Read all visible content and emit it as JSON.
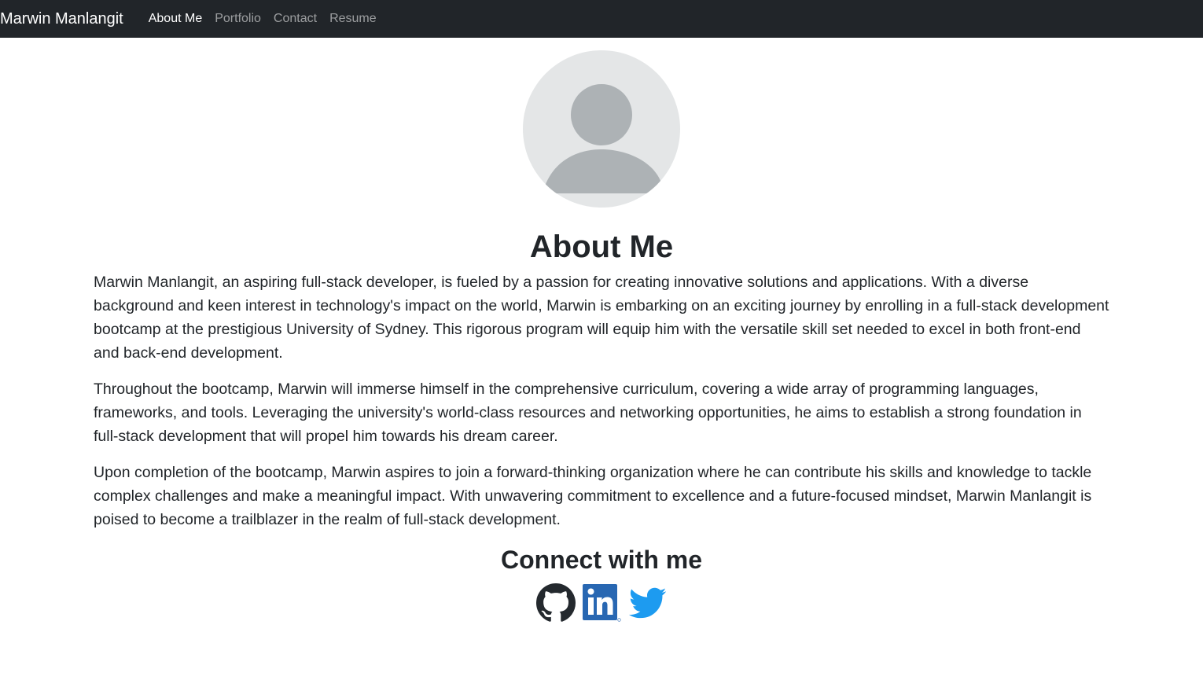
{
  "nav": {
    "brand": "Marwin Manlangit",
    "links": [
      {
        "label": "About Me"
      },
      {
        "label": "Portfolio"
      },
      {
        "label": "Contact"
      },
      {
        "label": "Resume"
      }
    ]
  },
  "about": {
    "heading": "About Me",
    "paragraphs": [
      "Marwin Manlangit, an aspiring full-stack developer, is fueled by a passion for creating innovative solutions and applications. With a diverse background and keen interest in technology's impact on the world, Marwin is embarking on an exciting journey by enrolling in a full-stack development bootcamp at the prestigious University of Sydney. This rigorous program will equip him with the versatile skill set needed to excel in both front-end and back-end development.",
      "Throughout the bootcamp, Marwin will immerse himself in the comprehensive curriculum, covering a wide array of programming languages, frameworks, and tools. Leveraging the university's world-class resources and networking opportunities, he aims to establish a strong foundation in full-stack development that will propel him towards his dream career.",
      "Upon completion of the bootcamp, Marwin aspires to join a forward-thinking organization where he can contribute his skills and knowledge to tackle complex challenges and make a meaningful impact. With unwavering commitment to excellence and a future-focused mindset, Marwin Manlangit is poised to become a trailblazer in the realm of full-stack development."
    ]
  },
  "connect": {
    "heading": "Connect with me",
    "icons": [
      "github-icon",
      "linkedin-icon",
      "twitter-icon"
    ]
  },
  "colors": {
    "navbar_bg": "#212529",
    "avatar_bg": "#e4e6e7",
    "avatar_fg": "#adb2b5",
    "linkedin": "#2867b2",
    "twitter": "#1d9bf0",
    "github": "#24292e"
  }
}
